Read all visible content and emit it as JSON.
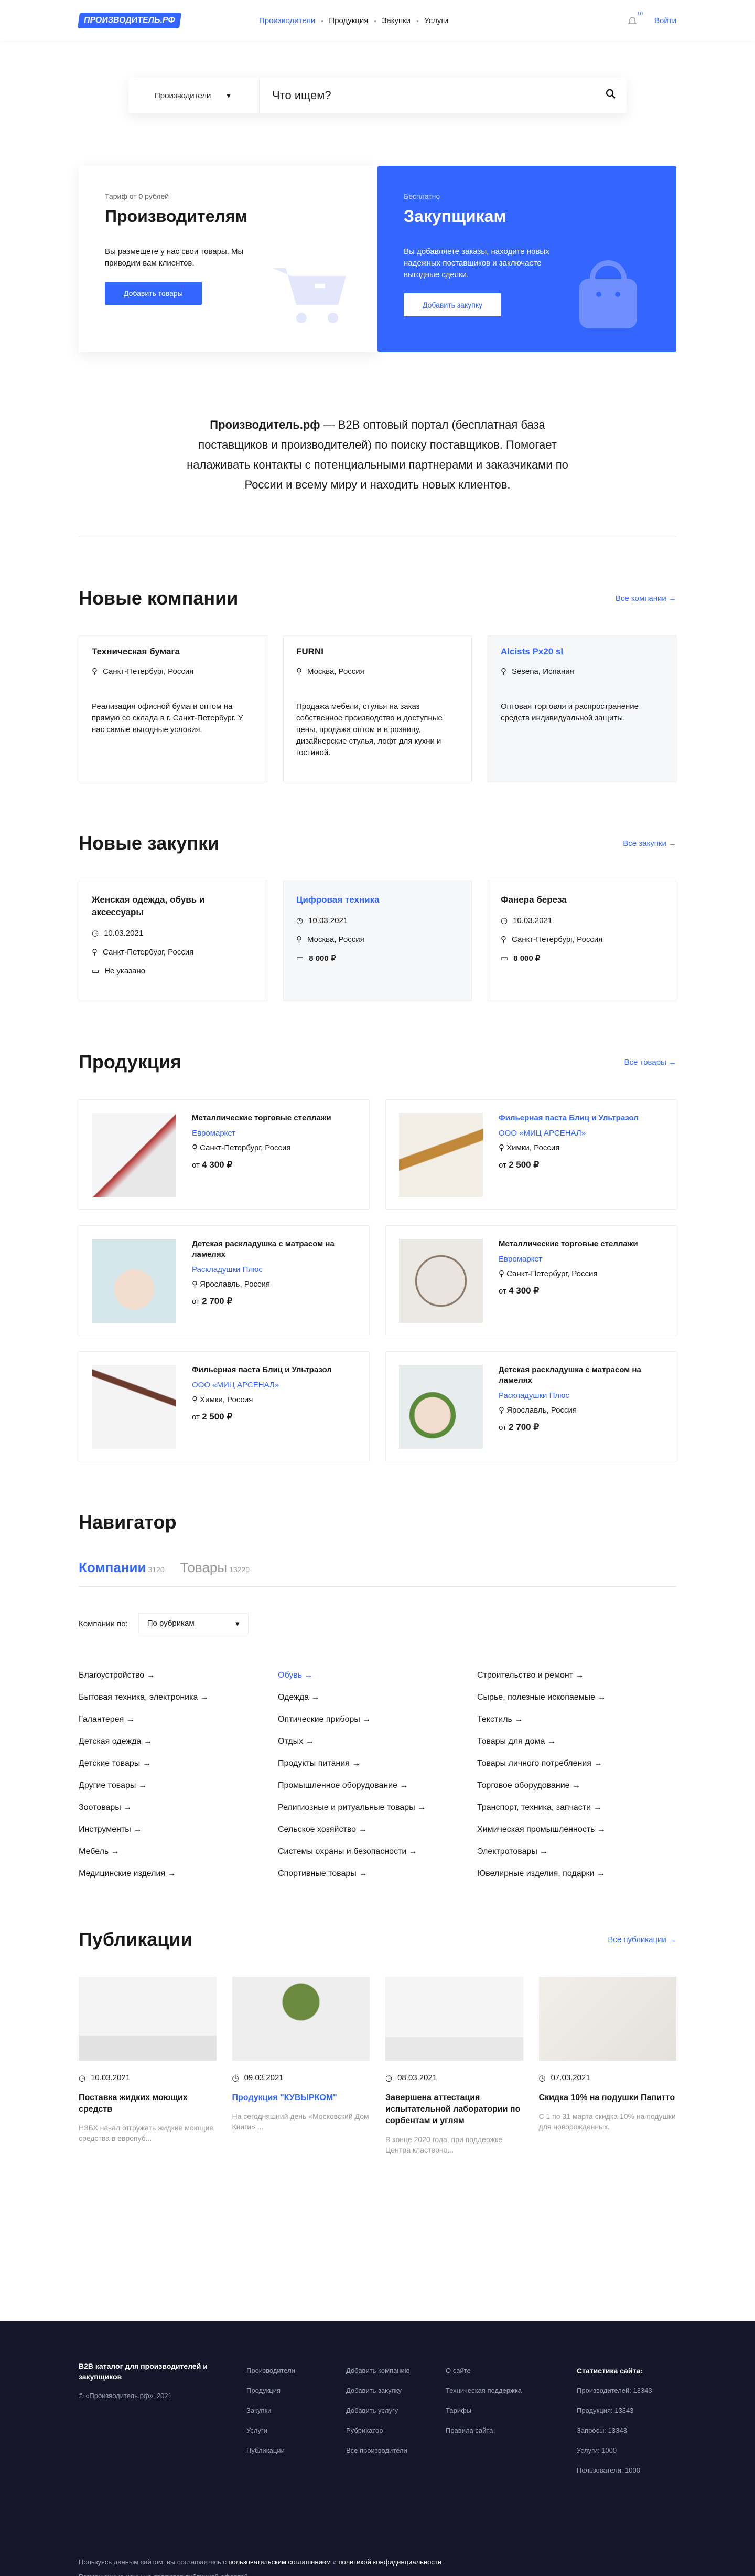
{
  "header": {
    "logo": "ПРОИЗВОДИТЕЛЬ.РФ",
    "nav": [
      "Производители",
      "Продукция",
      "Закупки",
      "Услуги"
    ],
    "notif": "10",
    "login": "Войти"
  },
  "search": {
    "category": "Производители",
    "placeholder": "Что ищем?"
  },
  "promo": {
    "left": {
      "tag": "Тариф от 0 рублей",
      "title": "Производителям",
      "text": "Вы размещете у нас свои товары. Мы приводим вам клиентов.",
      "button": "Добавить товары"
    },
    "right": {
      "tag": "Бесплатно",
      "title": "Закупщикам",
      "text": "Вы добавляете заказы, находите новых надежных поставщиков и заключаете выгодные сделки.",
      "button": "Добавить закупку"
    }
  },
  "intro": {
    "brand": "Производитель.рф",
    "text": " — B2B оптовый портал (бесплатная база поставщиков и производителей) по поиску поставщиков. Помогает налаживать контакты с потенциальными партнерами и заказчиками по России и всему миру и находить новых клиентов."
  },
  "companies": {
    "title": "Новые компании",
    "all": "Все компании",
    "items": [
      {
        "name": "Техническая бумага",
        "loc": "Санкт-Петербург, Россия",
        "desc": "Реализация офисной бумаги оптом на прямую со склада в г. Санкт-Петербург. У нас самые выгодные условия."
      },
      {
        "name": "FURNI",
        "loc": "Москва, Россия",
        "desc": "Продажа мебели, стулья на заказ собственное производство и доступные цены, продажа оптом и в розницу, дизайнерские стулья, лофт для кухни и гостиной."
      },
      {
        "name": "Alcists Px20 sl",
        "loc": "Sesena, Испания",
        "desc": "Оптовая торговля и распространение средств индивидуальной защиты."
      }
    ]
  },
  "purchases": {
    "title": "Новые закупки",
    "all": "Все закупки",
    "items": [
      {
        "name": "Женская одежда, обувь и аксессуары",
        "date": "10.03.2021",
        "loc": "Санкт-Петербург, Россия",
        "price": "Не указано"
      },
      {
        "name": "Цифровая техника",
        "date": "10.03.2021",
        "loc": "Москва, Россия",
        "price": "8 000 ₽"
      },
      {
        "name": "Фанера береза",
        "date": "10.03.2021",
        "loc": "Санкт-Петербург, Россия",
        "price": "8 000 ₽"
      }
    ]
  },
  "products": {
    "title": "Продукция",
    "all": "Все товары",
    "items": [
      {
        "name": "Металлические торговые стеллажи",
        "seller": "Евромаркет",
        "loc": "Санкт-Петербург, Россия",
        "price": "4 300 ₽"
      },
      {
        "name": "Фильерная паста Блиц и Ультразол",
        "seller": "ООО «МИЦ АРСЕНАЛ»",
        "loc": "Химки, Россия",
        "price": "2 500 ₽"
      },
      {
        "name": "Детская раскладушка с матрасом на ламелях",
        "seller": "Раскладушки Плюс",
        "loc": "Ярославль, Россия",
        "price": "2 700 ₽"
      },
      {
        "name": "Металлические торговые стеллажи",
        "seller": "Евромаркет",
        "loc": "Санкт-Петербург, Россия",
        "price": "4 300 ₽"
      },
      {
        "name": "Фильерная паста Блиц и Ультразол",
        "seller": "ООО «МИЦ АРСЕНАЛ»",
        "loc": "Химки, Россия",
        "price": "2 500 ₽"
      },
      {
        "name": "Детская раскладушка с матрасом на ламелях",
        "seller": "Раскладушки Плюс",
        "loc": "Ярославль, Россия",
        "price": "2 700 ₽"
      }
    ]
  },
  "navigator": {
    "title": "Навигатор",
    "tab1": "Компании",
    "tab1count": "3120",
    "tab2": "Товары",
    "tab2count": "13220",
    "filterLabel": "Компании по:",
    "filterValue": "По рубрикам",
    "cats": [
      "Благоустройство",
      "Обувь",
      "Строительство и ремонт",
      "Бытовая техника, электроника",
      "Одежда",
      "Сырье, полезные ископаемые",
      "Галантерея",
      "Оптические приборы",
      "Текстиль",
      "Детская одежда",
      "Отдых",
      "Товары для дома",
      "Детские товары",
      "Продукты питания",
      "Товары личного потребления",
      "Другие товары",
      "Промышленное оборудование",
      "Торговое оборудование",
      "Зоотовары",
      "Религиозные и ритуальные товары",
      "Транспорт, техника, запчасти",
      "Инструменты",
      "Сельское хозяйство",
      "Химическая промышленность",
      "Мебель",
      "Системы охраны и безопасности",
      "Электротовары",
      "Медицинские изделия",
      "Спортивные товары",
      "Ювелирные изделия, подарки"
    ]
  },
  "publications": {
    "title": "Публикации",
    "all": "Все публикации",
    "items": [
      {
        "date": "10.03.2021",
        "title": "Поставка жидких моющих средств",
        "text": "НЗБХ начал отгружать жидкие моющие средства в европуб..."
      },
      {
        "date": "09.03.2021",
        "title": "Продукция \"КУВЫРКОМ\"",
        "text": "На сегодняшний день «Московский Дом Книги» ..."
      },
      {
        "date": "08.03.2021",
        "title": "Завершена аттестация испытательной лаборатории по сорбентам и углям",
        "text": "В конце 2020 года, при поддержке Центра кластерно..."
      },
      {
        "date": "07.03.2021",
        "title": "Скидка 10% на подушки Папитто",
        "text": "С 1 по 31 марта скидка 10% на подушки для новорожденных."
      }
    ]
  },
  "footer": {
    "title": "B2B каталог для производителей и закупщиков",
    "copy": "© «Производитель.рф», 2021",
    "c1": [
      "Производители",
      "Продукция",
      "Закупки",
      "Услуги",
      "Публикации"
    ],
    "c2": [
      "Добавить компанию",
      "Добавить закупку",
      "Добавить услугу",
      "Рубрикатор",
      "Все производители"
    ],
    "c3": [
      "О сайте",
      "Техническая поддержка",
      "Тарифы",
      "Правила сайта"
    ],
    "statsTitle": "Статистика сайта:",
    "stats": [
      "Производителей: 13343",
      "Продукция: 13343",
      "Запросы: 13343",
      "Услуги: 1000",
      "Пользователи: 1000"
    ],
    "legal1": "Пользуясь данным сайтом, вы соглашаетесь с ",
    "agree": "пользовательским соглашением",
    "and": " и ",
    "privacy": "политикой конфиденциальности",
    "legal2": "Размещенные цены не являются публичной офертой"
  }
}
